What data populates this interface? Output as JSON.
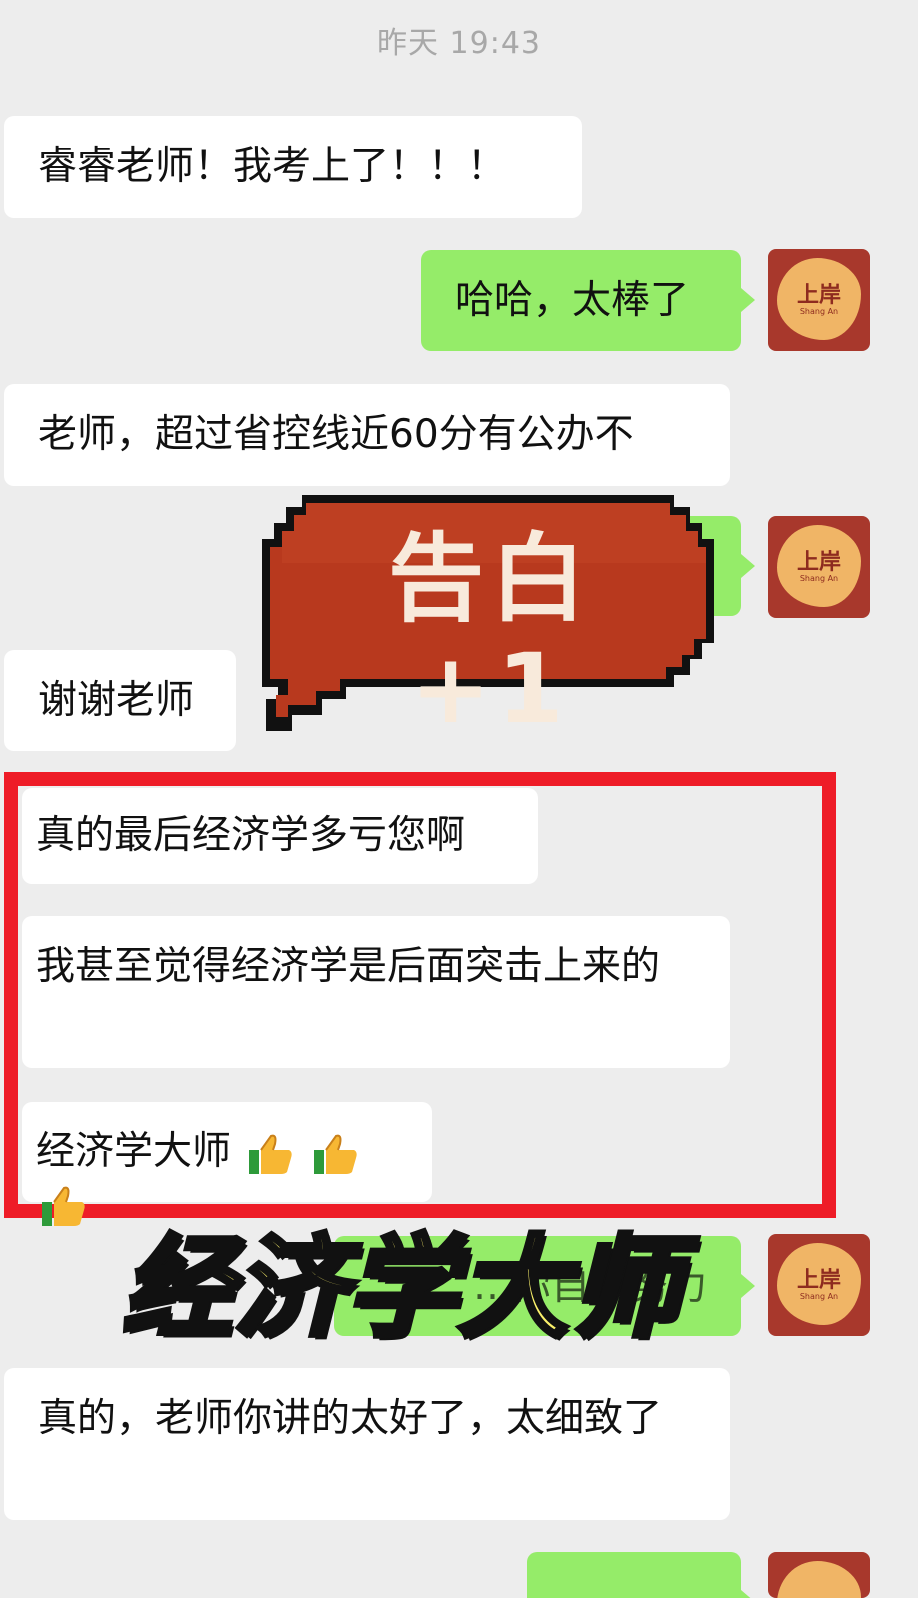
{
  "chat": {
    "timestamp": "昨天 19:43",
    "messages": [
      {
        "dir": "in",
        "text": "睿睿老师！我考上了！！！"
      },
      {
        "dir": "out",
        "text": "哈哈，太棒了"
      },
      {
        "dir": "in",
        "text": "老师，超过省控线近60分有公办不"
      },
      {
        "dir": "in",
        "text": "谢谢老师"
      },
      {
        "dir": "in",
        "text": "真的最后经济学多亏您啊"
      },
      {
        "dir": "in",
        "text": "我甚至觉得经济学是后面突击上来的"
      },
      {
        "dir": "in",
        "text": "经济学大师"
      },
      {
        "dir": "out",
        "text": "…你自…努力"
      },
      {
        "dir": "in",
        "text": "真的，老师你讲的太好了，太细致了"
      }
    ],
    "thumbs_emoji_count": 3,
    "avatar": {
      "text": "上岸",
      "sub": "Shang An"
    }
  },
  "overlay": {
    "badge": "告白 +1",
    "caption": "经济学大师",
    "colors": {
      "highlight_box": "#ee1c27",
      "badge_fill": "#b8391e",
      "caption_fill": "#fbf16b"
    }
  },
  "colors": {
    "background": "#ededed",
    "incoming_bubble": "#ffffff",
    "outgoing_bubble": "#95ec69"
  }
}
